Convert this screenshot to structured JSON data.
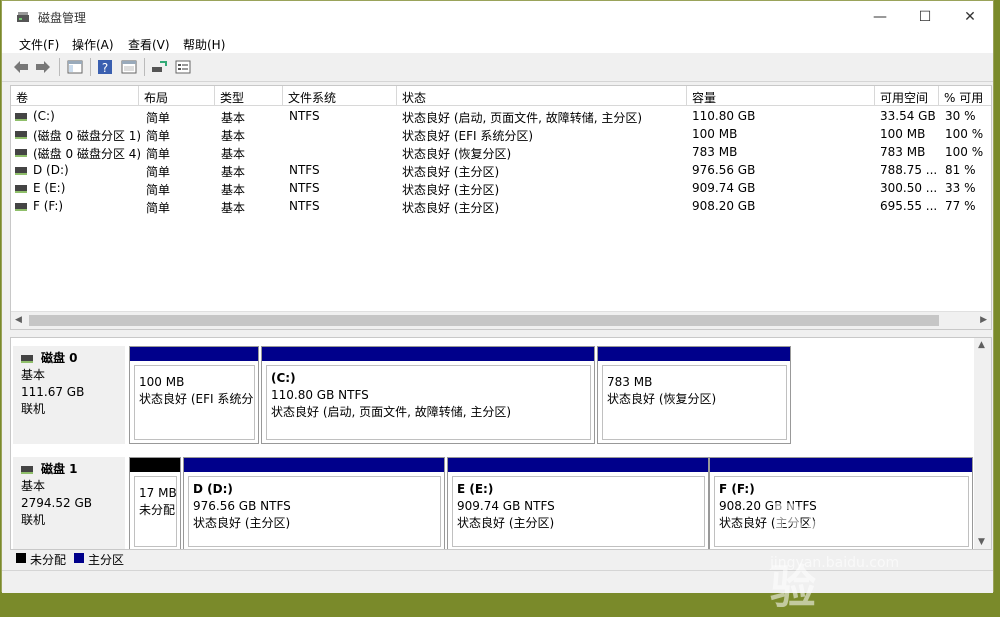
{
  "window": {
    "title": "磁盘管理"
  },
  "menu": [
    "文件(F)",
    "操作(A)",
    "查看(V)",
    "帮助(H)"
  ],
  "columns": [
    "卷",
    "布局",
    "类型",
    "文件系统",
    "状态",
    "容量",
    "可用空间",
    "% 可用"
  ],
  "volumes": [
    {
      "name": "(C:)",
      "layout": "简单",
      "type": "基本",
      "fs": "NTFS",
      "status": "状态良好 (启动, 页面文件, 故障转储, 主分区)",
      "capacity": "110.80 GB",
      "free": "33.54 GB",
      "pct": "30 %"
    },
    {
      "name": "(磁盘 0 磁盘分区 1)",
      "layout": "简单",
      "type": "基本",
      "fs": "",
      "status": "状态良好 (EFI 系统分区)",
      "capacity": "100 MB",
      "free": "100 MB",
      "pct": "100 %"
    },
    {
      "name": "(磁盘 0 磁盘分区 4)",
      "layout": "简单",
      "type": "基本",
      "fs": "",
      "status": "状态良好 (恢复分区)",
      "capacity": "783 MB",
      "free": "783 MB",
      "pct": "100 %"
    },
    {
      "name": "D (D:)",
      "layout": "简单",
      "type": "基本",
      "fs": "NTFS",
      "status": "状态良好 (主分区)",
      "capacity": "976.56 GB",
      "free": "788.75 ...",
      "pct": "81 %"
    },
    {
      "name": "E (E:)",
      "layout": "简单",
      "type": "基本",
      "fs": "NTFS",
      "status": "状态良好 (主分区)",
      "capacity": "909.74 GB",
      "free": "300.50 ...",
      "pct": "33 %"
    },
    {
      "name": "F (F:)",
      "layout": "简单",
      "type": "基本",
      "fs": "NTFS",
      "status": "状态良好 (主分区)",
      "capacity": "908.20 GB",
      "free": "695.55 ...",
      "pct": "77 %"
    }
  ],
  "disks": [
    {
      "name": "磁盘 0",
      "kind": "基本",
      "size": "111.67 GB",
      "state": "联机",
      "partitions": [
        {
          "label": "",
          "size": "100 MB",
          "status": "状态良好 (EFI 系统分区)"
        },
        {
          "label": "(C:)",
          "size": "110.80 GB NTFS",
          "status": "状态良好 (启动, 页面文件, 故障转储, 主分区)"
        },
        {
          "label": "",
          "size": "783 MB",
          "status": "状态良好 (恢复分区)"
        }
      ]
    },
    {
      "name": "磁盘 1",
      "kind": "基本",
      "size": "2794.52 GB",
      "state": "联机",
      "partitions": [
        {
          "label": "",
          "size": "17 MB",
          "status": "未分配"
        },
        {
          "label": "D  (D:)",
          "size": "976.56 GB NTFS",
          "status": "状态良好 (主分区)"
        },
        {
          "label": "E  (E:)",
          "size": "909.74 GB NTFS",
          "status": "状态良好 (主分区)"
        },
        {
          "label": "F  (F:)",
          "size": "908.20 GB NTFS",
          "status": "状态良好 (主分区)"
        }
      ]
    }
  ],
  "legend": {
    "unallocated": "未分配",
    "primary": "主分区"
  },
  "colors": {
    "primary": "#00008b",
    "unallocated": "#000000"
  },
  "watermark": {
    "main": "Baidu经验",
    "sub": "jingyan.baidu.com"
  }
}
